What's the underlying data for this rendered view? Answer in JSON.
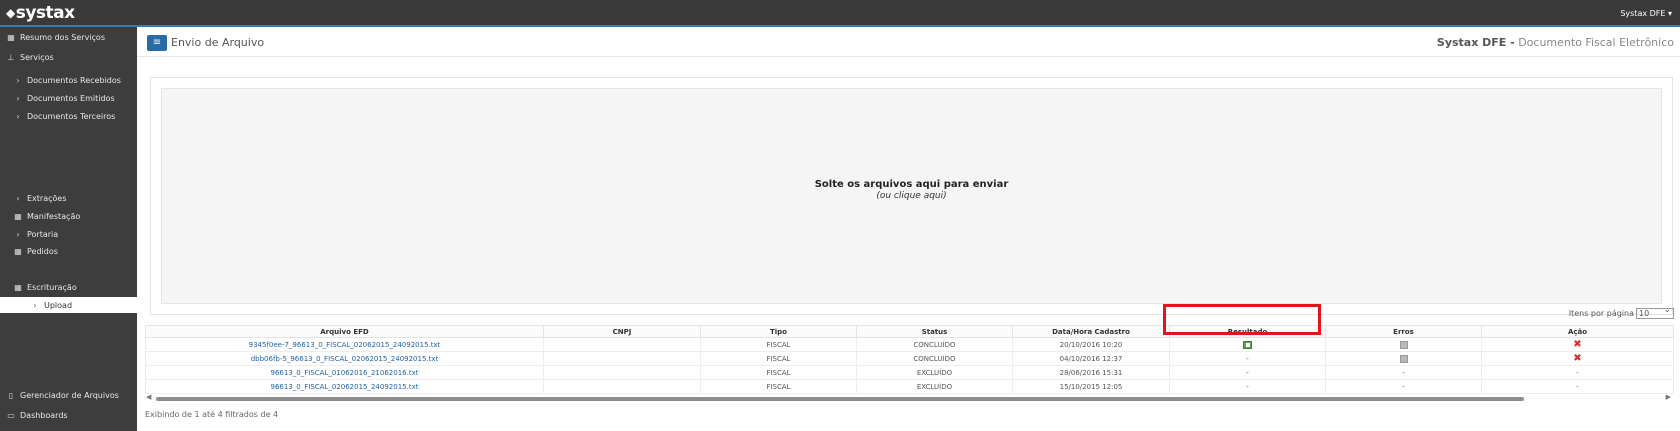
{
  "topbar": {
    "logo_text": "systax",
    "user_menu": "Systax DFE ▾"
  },
  "sidebar": {
    "items": [
      {
        "label": "Resumo dos Serviços",
        "icon": "grid-icon"
      },
      {
        "label": "Serviços",
        "icon": "sitemap-icon"
      },
      {
        "label": "Documentos Recebidos",
        "icon": "chevron-right-icon"
      },
      {
        "label": "Documentos Emitidos",
        "icon": "chevron-right-icon"
      },
      {
        "label": "Documentos Terceiros",
        "icon": "chevron-right-icon"
      },
      {
        "label": "Extrações",
        "icon": "chevron-right-icon"
      },
      {
        "label": "Manifestação",
        "icon": "grid-icon"
      },
      {
        "label": "Portaria",
        "icon": "chevron-right-icon"
      },
      {
        "label": "Pedidos",
        "icon": "grid-icon"
      },
      {
        "label": "Escrituração",
        "icon": "grid-icon"
      },
      {
        "label": "Upload",
        "icon": "chevron-right-icon"
      }
    ],
    "bottom": [
      {
        "label": "Gerenciador de Arquivos",
        "icon": "file-icon"
      },
      {
        "label": "Dashboards",
        "icon": "dashboard-icon"
      }
    ]
  },
  "header": {
    "menu_icon": "hamburger-icon",
    "page_title": "Envio de Arquivo",
    "brand_bold": "Systax DFE -",
    "brand_rest": " Documento Fiscal Eletrônico"
  },
  "dropzone": {
    "message": "Solte os arquivos aqui para enviar",
    "sub_message": "(ou clique aqui)"
  },
  "pagination": {
    "per_page_label": "Itens por página",
    "per_page_value": "10"
  },
  "table": {
    "columns": [
      "Arquivo EFD",
      "CNPJ",
      "Tipo",
      "Status",
      "Data/Hora Cadastro",
      "Resultado",
      "Erros",
      "Ação"
    ],
    "rows": [
      {
        "arquivo": "9345f0ee-7_96613_0_FISCAL_02062015_24092015.txt",
        "cnpj": "",
        "tipo": "FISCAL",
        "status": "CONCLUÍDO",
        "data": "20/10/2016 10:20",
        "resultado": "excel-icon",
        "erros": "document-icon",
        "acao": "delete-icon"
      },
      {
        "arquivo": "dbb06fb-5_96613_0_FISCAL_02062015_24092015.txt",
        "cnpj": "",
        "tipo": "FISCAL",
        "status": "CONCLUÍDO",
        "data": "04/10/2016 12:37",
        "resultado": "-",
        "erros": "document-icon",
        "acao": "delete-icon"
      },
      {
        "arquivo": "96613_0_FISCAL_01062016_21062016.txt",
        "cnpj": "",
        "tipo": "FISCAL",
        "status": "EXCLUÍDO",
        "data": "28/06/2016 15:31",
        "resultado": "-",
        "erros": "-",
        "acao": "-"
      },
      {
        "arquivo": "96613_0_FISCAL_02062015_24092015.txt",
        "cnpj": "",
        "tipo": "FISCAL",
        "status": "EXCLUÍDO",
        "data": "15/10/2015 12:05",
        "resultado": "-",
        "erros": "-",
        "acao": "-"
      }
    ]
  },
  "footer_info": "Exibindo de 1 até 4 filtrados de 4",
  "colors": {
    "topbar": "#3a3a3a",
    "accent": "#2f7ec2",
    "sidebar": "#3d3d3d",
    "link": "#1e62a8",
    "highlight": "#e0161c",
    "delete": "#e02828"
  }
}
